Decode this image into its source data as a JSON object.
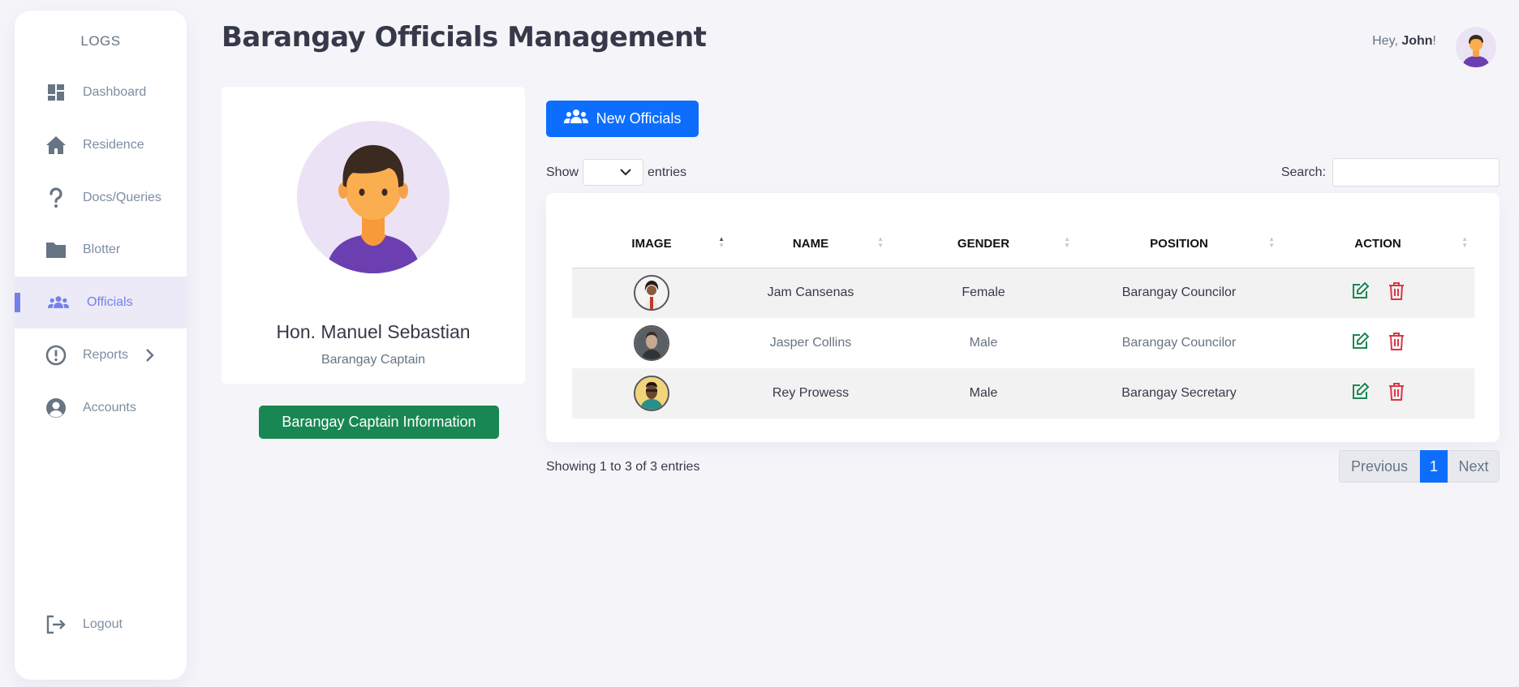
{
  "sidebar": {
    "brand": "LOGS",
    "items": [
      {
        "label": "Dashboard"
      },
      {
        "label": "Residence"
      },
      {
        "label": "Docs/Queries"
      },
      {
        "label": "Blotter"
      },
      {
        "label": "Officials"
      },
      {
        "label": "Reports"
      },
      {
        "label": "Accounts"
      }
    ],
    "logout": "Logout"
  },
  "header": {
    "title": "Barangay Officials Management",
    "greeting_prefix": "Hey, ",
    "user": "John",
    "greeting_suffix": "!"
  },
  "captain": {
    "name": "Hon. Manuel Sebastian",
    "title": "Barangay Captain",
    "button": "Barangay Captain Information"
  },
  "toolbar": {
    "new_button": "New Officials",
    "show": "Show",
    "entries": "entries",
    "search": "Search:"
  },
  "table": {
    "headers": [
      "IMAGE",
      "NAME",
      "GENDER",
      "POSITION",
      "ACTION"
    ],
    "rows": [
      {
        "name": "Jam Cansenas",
        "gender": "Female",
        "position": "Barangay Councilor"
      },
      {
        "name": "Jasper Collins",
        "gender": "Male",
        "position": "Barangay Councilor"
      },
      {
        "name": "Rey Prowess",
        "gender": "Male",
        "position": "Barangay Secretary"
      }
    ]
  },
  "footer": {
    "info": "Showing 1 to 3 of 3 entries",
    "previous": "Previous",
    "page": "1",
    "next": "Next"
  },
  "colors": {
    "accent": "#7380ec",
    "primary_button": "#0d6efd",
    "success_button": "#198754",
    "edit_icon": "#198754",
    "delete_icon": "#dc3545"
  }
}
